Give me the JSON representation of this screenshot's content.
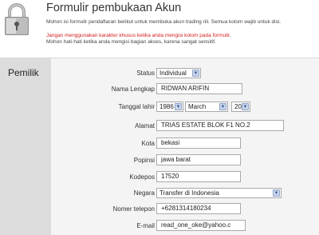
{
  "header": {
    "title": "Formulir pembukaan Akun",
    "intro": "Mohon isi formulir pendaftaran berikut untuk membuka akun trading riil. Semua kolom wajib untuk disi.",
    "warning": "Jangan menggunakan karakter khusus ketika anda mengisi kolom pada formulir.",
    "note": "Mohon hati-hati ketika anda mengisi bagian akses, karena sangat sensitif."
  },
  "section": {
    "title": "Pemilik"
  },
  "fields": {
    "status": {
      "label": "Status",
      "value": "Individual"
    },
    "nama": {
      "label": "Nama Lengkap",
      "value": "RIDWAN ARIFIN"
    },
    "tanggal": {
      "label": "Tanggal lahir",
      "year": "1986",
      "month": "March",
      "day": "20"
    },
    "alamat": {
      "label": "Alamat",
      "value": "TRIAS ESTATE BLOK F1 NO.2"
    },
    "kota": {
      "label": "Kota",
      "value": "bekasi"
    },
    "propinsi": {
      "label": "Popinsi",
      "value": "jawa barat"
    },
    "kodepos": {
      "label": "Kodepos",
      "value": "17520"
    },
    "negara": {
      "label": "Negara",
      "value": "Transfer di Indonesia"
    },
    "telepon": {
      "label": "Nomer telepon",
      "value": "+6281314180234"
    },
    "email": {
      "label": "E-mail",
      "value": "read_one_oke@yahoo.c"
    }
  },
  "icons": {
    "header": "padlock-icon",
    "dropdown": "chevron-down-icon"
  }
}
